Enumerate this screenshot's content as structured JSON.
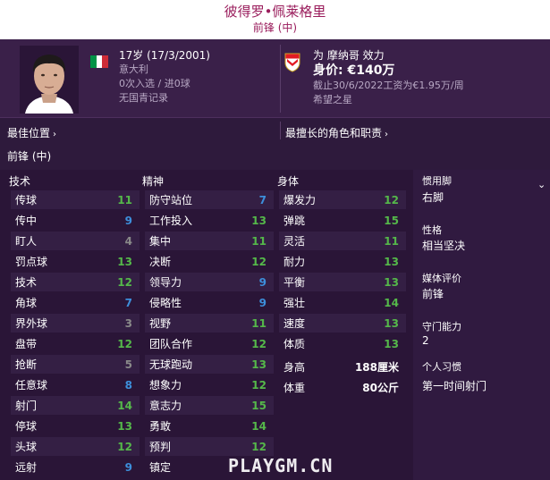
{
  "header": {
    "player_name": "彼得罗•佩莱格里",
    "position": "前锋 (中)"
  },
  "profile": {
    "age_dob": "17岁 (17/3/2001)",
    "nationality": "意大利",
    "caps": "0次入选 / 进0球",
    "youth_record": "无国青记录",
    "club_line": "为 摩纳哥 效力",
    "value": "身价: €140万",
    "contract": "截止30/6/2022工资为€1.95万/周",
    "status": "希望之星",
    "flag_colors": [
      "#009246",
      "#ffffff",
      "#ce2b37"
    ],
    "club_colors": [
      "#e21b23",
      "#ffffff",
      "#c9a227"
    ]
  },
  "positions": {
    "best_position_label": "最佳位置",
    "best_position_value": "前锋 (中)",
    "best_role_label": "最擅长的角色和职责"
  },
  "attributes": {
    "technical_header": "技术",
    "mental_header": "精神",
    "physical_header": "身体",
    "technical": [
      {
        "name": "传球",
        "value": "11"
      },
      {
        "name": "传中",
        "value": "9"
      },
      {
        "name": "盯人",
        "value": "4"
      },
      {
        "name": "罚点球",
        "value": "13"
      },
      {
        "name": "技术",
        "value": "12"
      },
      {
        "name": "角球",
        "value": "7"
      },
      {
        "name": "界外球",
        "value": "3"
      },
      {
        "name": "盘带",
        "value": "12"
      },
      {
        "name": "抢断",
        "value": "5"
      },
      {
        "name": "任意球",
        "value": "8"
      },
      {
        "name": "射门",
        "value": "14"
      },
      {
        "name": "停球",
        "value": "13"
      },
      {
        "name": "头球",
        "value": "12"
      },
      {
        "name": "远射",
        "value": "9"
      }
    ],
    "mental": [
      {
        "name": "防守站位",
        "value": "7"
      },
      {
        "name": "工作投入",
        "value": "13"
      },
      {
        "name": "集中",
        "value": "11"
      },
      {
        "name": "决断",
        "value": "12"
      },
      {
        "name": "领导力",
        "value": "9"
      },
      {
        "name": "侵略性",
        "value": "9"
      },
      {
        "name": "视野",
        "value": "11"
      },
      {
        "name": "团队合作",
        "value": "12"
      },
      {
        "name": "无球跑动",
        "value": "13"
      },
      {
        "name": "想象力",
        "value": "12"
      },
      {
        "name": "意志力",
        "value": "15"
      },
      {
        "name": "勇敢",
        "value": "14"
      },
      {
        "name": "预判",
        "value": "12"
      },
      {
        "name": "镇定",
        "value": ""
      }
    ],
    "physical": [
      {
        "name": "爆发力",
        "value": "12"
      },
      {
        "name": "弹跳",
        "value": "15"
      },
      {
        "name": "灵活",
        "value": "11"
      },
      {
        "name": "耐力",
        "value": "13"
      },
      {
        "name": "平衡",
        "value": "13"
      },
      {
        "name": "强壮",
        "value": "14"
      },
      {
        "name": "速度",
        "value": "13"
      },
      {
        "name": "体质",
        "value": "13"
      }
    ],
    "height_label": "身高",
    "height_value": "188厘米",
    "weight_label": "体重",
    "weight_value": "80公斤"
  },
  "side_panel": {
    "foot_label": "惯用脚",
    "foot_value": "右脚",
    "personality_label": "性格",
    "personality_value": "相当坚决",
    "media_label": "媒体评价",
    "media_value": "前锋",
    "gk_label": "守门能力",
    "gk_value": "2",
    "habit_label": "个人习惯",
    "habit_value": "第一时间射门"
  },
  "watermark": "PLAYGM.CN",
  "value_colors": {
    "low": "#8a8a8a",
    "mid": "#3d8fdb",
    "good": "#55b84a"
  }
}
